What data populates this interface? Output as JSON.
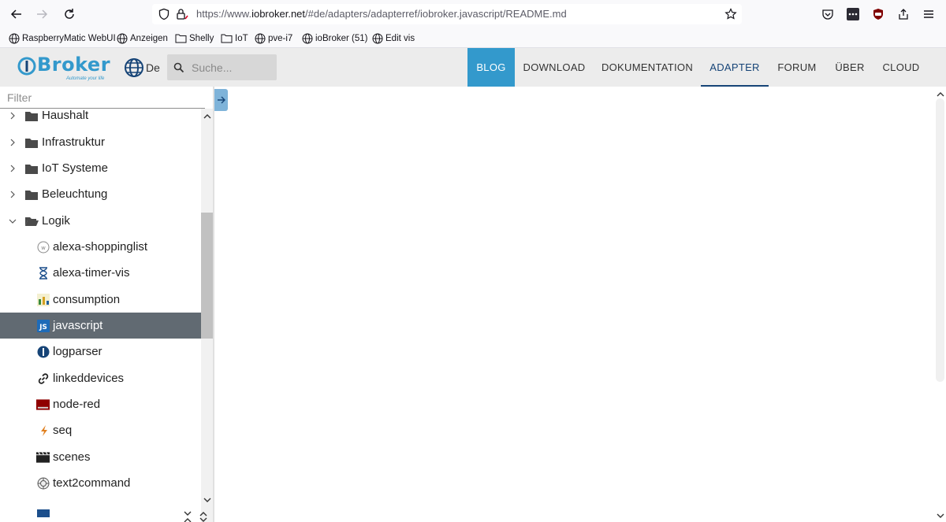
{
  "browser": {
    "url_prefix": "https://www.",
    "url_domain": "iobroker.net",
    "url_path": "/#de/adapters/adapterref/iobroker.javascript/README.md"
  },
  "bookmarks": [
    {
      "label": "RaspberryMatic WebUI",
      "icon": "globe-icon"
    },
    {
      "label": "Anzeigen",
      "icon": "globe-icon"
    },
    {
      "label": "Shelly",
      "icon": "folder-icon"
    },
    {
      "label": "IoT",
      "icon": "folder-icon"
    },
    {
      "label": "pve-i7",
      "icon": "globe-icon"
    },
    {
      "label": "ioBroker (51)",
      "icon": "globe-icon"
    },
    {
      "label": "Edit vis",
      "icon": "globe-icon"
    }
  ],
  "site": {
    "logo_text": "Broker",
    "logo_slogan": "Automate your life",
    "lang": "De",
    "search_placeholder": "Suche...",
    "menu": [
      "BLOG",
      "DOWNLOAD",
      "DOKUMENTATION",
      "ADAPTER",
      "FORUM",
      "ÜBER",
      "CLOUD"
    ],
    "active_menu": "ADAPTER"
  },
  "sidebar": {
    "filter_label": "Filter",
    "categories": [
      {
        "label": "Haushalt",
        "expanded": false
      },
      {
        "label": "Infrastruktur",
        "expanded": false
      },
      {
        "label": "IoT Systeme",
        "expanded": false
      },
      {
        "label": "Beleuchtung",
        "expanded": false
      },
      {
        "label": "Logik",
        "expanded": true
      }
    ],
    "items": [
      {
        "label": "alexa-shoppinglist",
        "icon": "alexa-shoppinglist-icon"
      },
      {
        "label": "alexa-timer-vis",
        "icon": "hourglass-icon"
      },
      {
        "label": "consumption",
        "icon": "consumption-icon"
      },
      {
        "label": "javascript",
        "icon": "javascript-icon",
        "selected": true
      },
      {
        "label": "logparser",
        "icon": "logparser-icon"
      },
      {
        "label": "linkeddevices",
        "icon": "link-icon"
      },
      {
        "label": "node-red",
        "icon": "node-red-icon"
      },
      {
        "label": "seq",
        "icon": "seq-icon"
      },
      {
        "label": "scenes",
        "icon": "clapperboard-icon"
      },
      {
        "label": "text2command",
        "icon": "text2command-icon"
      }
    ]
  },
  "colors": {
    "accent": "#3399cc",
    "active_menu": "#164477",
    "selected_row": "#616a72"
  }
}
